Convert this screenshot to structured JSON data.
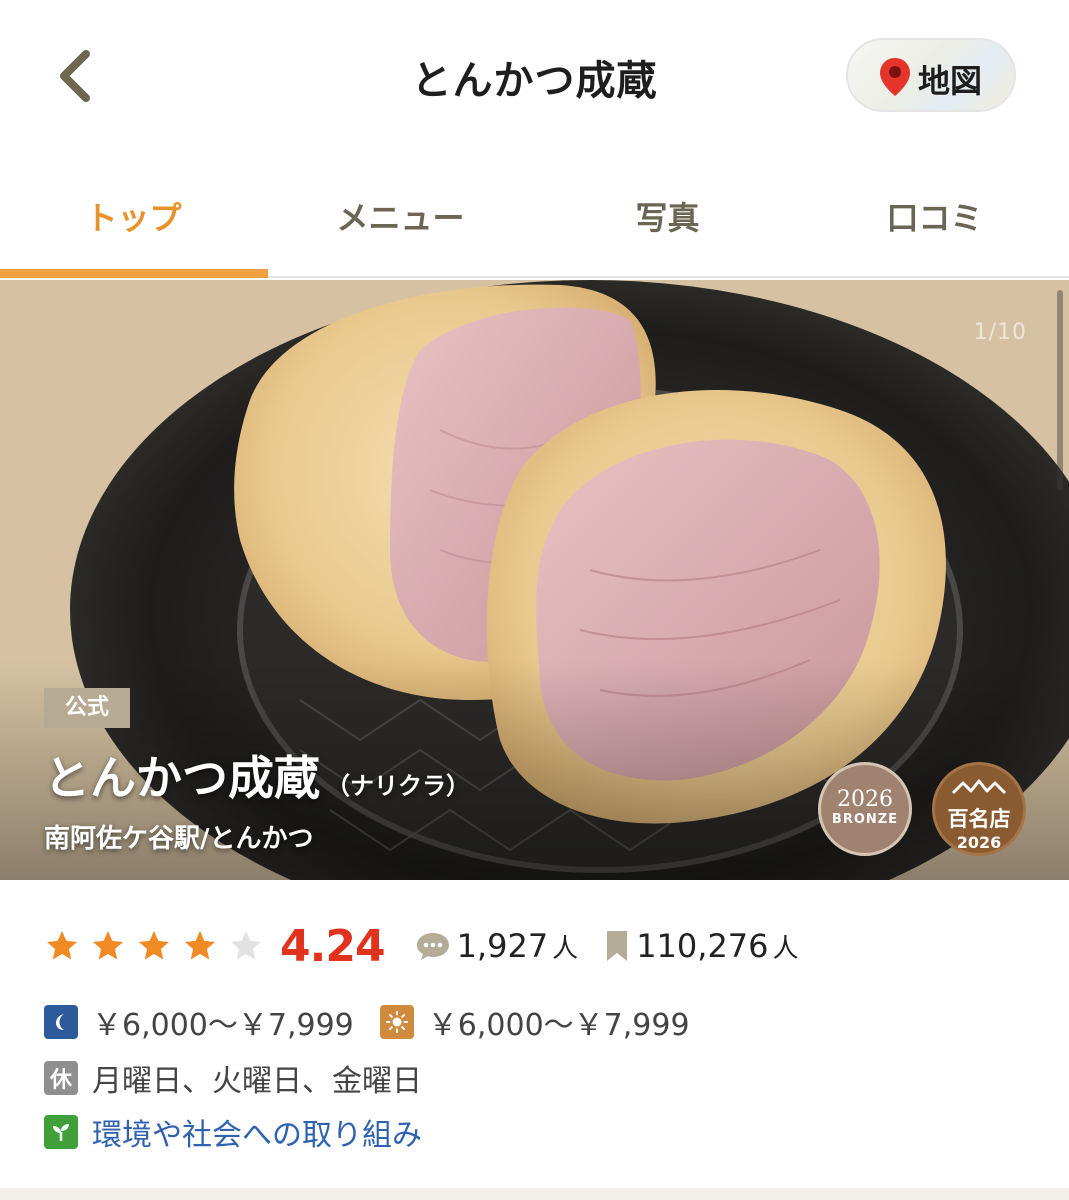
{
  "header": {
    "title": "とんかつ成蔵",
    "map_label": "地図"
  },
  "tabs": [
    {
      "label": "トップ",
      "active": true
    },
    {
      "label": "メニュー",
      "active": false
    },
    {
      "label": "写真",
      "active": false
    },
    {
      "label": "口コミ",
      "active": false
    }
  ],
  "hero": {
    "counter": "1/10",
    "official_badge": "公式",
    "name": "とんかつ成蔵",
    "kana": "（ナリクラ）",
    "subtitle": "南阿佐ケ谷駅/とんかつ",
    "awards": {
      "bronze_year": "2026",
      "bronze_label": "BRONZE",
      "hyaku_label": "百名店",
      "hyaku_year": "2026"
    }
  },
  "rating": {
    "score": "4.24",
    "stars": 4.24,
    "reviews": "1,927",
    "reviews_unit": "人",
    "saves": "110,276",
    "saves_unit": "人"
  },
  "prices": {
    "dinner": "￥6,000～￥7,999",
    "lunch": "￥6,000～￥7,999"
  },
  "holiday": {
    "icon_label": "休",
    "text": "月曜日、火曜日、金曜日"
  },
  "eco": {
    "link": "環境や社会への取り組み"
  },
  "colors": {
    "accent": "#e8922a",
    "score": "#e0321c",
    "star": "#f08a24",
    "link": "#2e62b0"
  }
}
